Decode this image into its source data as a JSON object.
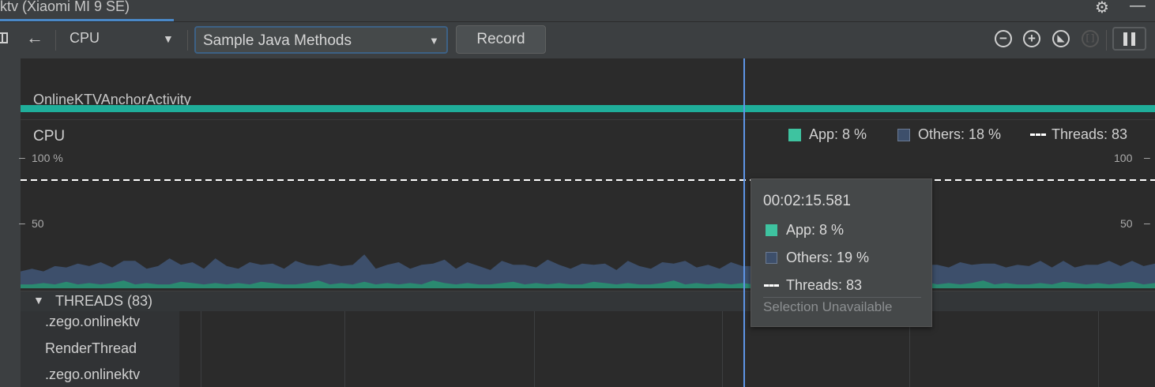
{
  "window": {
    "title": "ktv (Xiaomi MI 9 SE)"
  },
  "toolbar": {
    "profiler": "CPU",
    "recording_mode": "Sample Java Methods",
    "record_label": "Record"
  },
  "activity": {
    "name": "OnlineKTVAnchorActivity"
  },
  "cpu": {
    "title": "CPU",
    "legend": {
      "app": "App: 8 %",
      "others": "Others: 18 %",
      "threads": "Threads: 83"
    },
    "axis": {
      "top_left": "100 %",
      "top_right": "100",
      "mid_left": "50",
      "mid_right": "50"
    }
  },
  "colors": {
    "app": "#3ec3a0",
    "others": "#3d4f6b",
    "activity": "#1fae9a",
    "cursor": "#5e95e6"
  },
  "chart_data": {
    "type": "area",
    "title": "CPU",
    "ylim": [
      0,
      100
    ],
    "threads_line": 83,
    "series": [
      {
        "name": "App",
        "values": [
          3,
          3,
          4,
          3,
          5,
          3,
          4,
          3,
          4,
          6,
          3,
          4,
          3,
          3,
          5,
          4,
          3,
          4,
          3,
          4,
          3,
          5,
          4,
          3,
          3,
          4,
          6,
          3,
          4,
          3,
          5,
          3,
          4,
          3,
          4,
          3,
          6,
          4,
          3,
          4,
          3,
          3,
          4,
          5,
          3,
          4,
          3,
          4,
          3,
          3,
          5,
          4,
          3,
          4,
          3,
          3,
          4,
          6,
          3,
          4,
          3,
          4,
          3,
          4,
          3,
          5,
          3,
          4,
          3,
          4,
          3,
          3,
          5,
          4,
          3,
          4,
          3,
          4,
          3,
          5,
          3,
          4,
          3,
          4,
          6,
          3,
          4,
          3,
          3,
          4,
          3,
          5,
          4,
          3,
          4,
          3,
          4,
          5,
          3,
          4
        ]
      },
      {
        "name": "Others",
        "values": [
          10,
          12,
          9,
          14,
          11,
          16,
          13,
          17,
          12,
          15,
          18,
          11,
          14,
          20,
          13,
          16,
          12,
          19,
          14,
          11,
          17,
          13,
          15,
          12,
          18,
          14,
          11,
          16,
          13,
          15,
          21,
          12,
          14,
          17,
          11,
          15,
          13,
          18,
          12,
          16,
          14,
          11,
          17,
          13,
          15,
          12,
          19,
          14,
          12,
          16,
          13,
          15,
          11,
          17,
          14,
          12,
          16,
          13,
          18,
          12,
          15,
          11,
          17,
          13,
          14,
          16,
          12,
          15,
          13,
          18,
          14,
          11,
          16,
          13,
          15,
          12,
          17,
          14,
          16,
          13,
          15,
          12,
          17,
          14,
          13,
          16,
          12,
          15,
          14,
          17,
          13,
          16,
          12,
          15,
          14,
          18,
          13,
          16,
          14,
          15
        ]
      }
    ]
  },
  "tooltip": {
    "time": "00:02:15.581",
    "app": "App: 8 %",
    "others": "Others: 19 %",
    "threads": "Threads: 83",
    "selection": "Selection Unavailable"
  },
  "threads": {
    "title": "THREADS (83)",
    "names": [
      ".zego.onlinektv",
      "RenderThread",
      ".zego.onlinektv"
    ]
  }
}
